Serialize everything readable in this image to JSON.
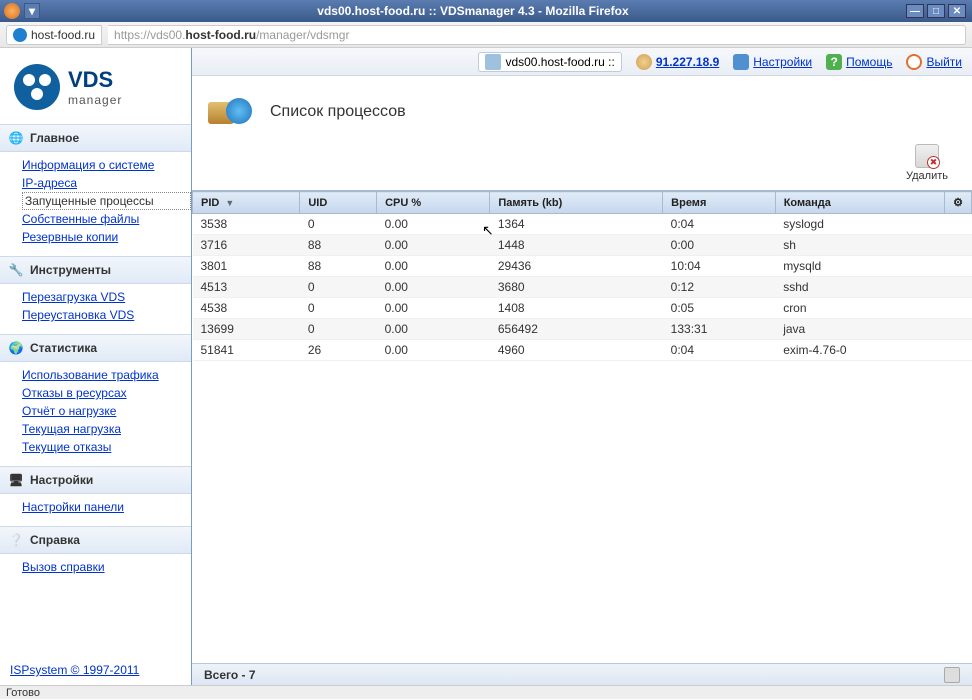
{
  "window": {
    "title": "vds00.host-food.ru :: VDSmanager 4.3 - Mozilla Firefox"
  },
  "address": {
    "short_domain": "host-food.ru",
    "url_prefix": "https://vds00.",
    "url_bold": "host-food.ru",
    "url_suffix": "/manager/vdsmgr"
  },
  "logo": {
    "line1": "VDS",
    "line2": "manager"
  },
  "top": {
    "host": "vds00.host-food.ru ::",
    "ip": "91.227.18.9",
    "settings": "Настройки",
    "help": "Помощь",
    "exit": "Выйти"
  },
  "page": {
    "title": "Список процессов",
    "delete": "Удалить",
    "total": "Всего - 7",
    "status": "Готово"
  },
  "nav": {
    "main": {
      "title": "Главное",
      "items": [
        "Информация о системе",
        "IP-адреса",
        "Запущенные процессы",
        "Собственные файлы",
        "Резервные копии"
      ],
      "selected": 2
    },
    "tools": {
      "title": "Инструменты",
      "items": [
        "Перезагрузка VDS",
        "Переустановка VDS"
      ]
    },
    "stats": {
      "title": "Статистика",
      "items": [
        "Использование трафика",
        "Отказы в ресурсах",
        "Отчёт о нагрузке",
        "Текущая нагрузка",
        "Текущие отказы"
      ]
    },
    "settings": {
      "title": "Настройки",
      "items": [
        "Настройки панели"
      ]
    },
    "help": {
      "title": "Справка",
      "items": [
        "Вызов справки"
      ]
    }
  },
  "copyright": "ISPsystem © 1997-2011",
  "columns": [
    "PID",
    "UID",
    "CPU %",
    "Память (kb)",
    "Время",
    "Команда"
  ],
  "rows": [
    {
      "pid": "3538",
      "uid": "0",
      "cpu": "0.00",
      "mem": "1364",
      "time": "0:04",
      "cmd": "syslogd"
    },
    {
      "pid": "3716",
      "uid": "88",
      "cpu": "0.00",
      "mem": "1448",
      "time": "0:00",
      "cmd": "sh"
    },
    {
      "pid": "3801",
      "uid": "88",
      "cpu": "0.00",
      "mem": "29436",
      "time": "10:04",
      "cmd": "mysqld"
    },
    {
      "pid": "4513",
      "uid": "0",
      "cpu": "0.00",
      "mem": "3680",
      "time": "0:12",
      "cmd": "sshd"
    },
    {
      "pid": "4538",
      "uid": "0",
      "cpu": "0.00",
      "mem": "1408",
      "time": "0:05",
      "cmd": "cron"
    },
    {
      "pid": "13699",
      "uid": "0",
      "cpu": "0.00",
      "mem": "656492",
      "time": "133:31",
      "cmd": "java"
    },
    {
      "pid": "51841",
      "uid": "26",
      "cpu": "0.00",
      "mem": "4960",
      "time": "0:04",
      "cmd": "exim-4.76-0"
    }
  ]
}
